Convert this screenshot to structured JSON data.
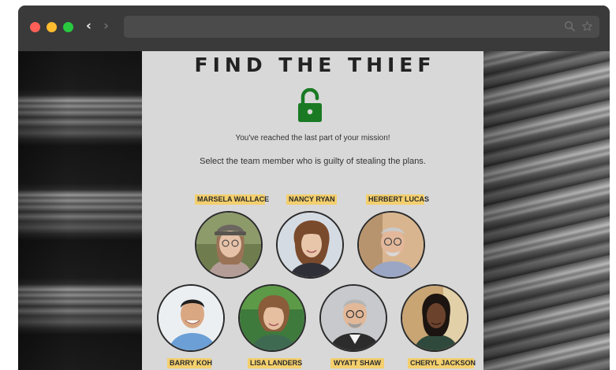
{
  "browser": {
    "window_controls": [
      "close",
      "minimize",
      "maximize"
    ],
    "nav": {
      "back": "‹",
      "forward": "›"
    },
    "address_bar": {
      "value": "",
      "icons": [
        "search-icon",
        "star-icon"
      ]
    }
  },
  "page": {
    "title": "FIND THE THIEF",
    "icon": "unlocked-padlock-icon",
    "icon_color": "#1a7a24",
    "message_1": "You've reached the last part of your mission!",
    "message_2": "Select the team member who is guilty of stealing the plans.",
    "label_color": "#f3cf6d",
    "suspects": [
      {
        "name": "MARSELA WALLACE"
      },
      {
        "name": "NANCY RYAN"
      },
      {
        "name": "HERBERT LUCAS"
      },
      {
        "name": "BARRY KOH"
      },
      {
        "name": "LISA LANDERS"
      },
      {
        "name": "WYATT SHAW"
      },
      {
        "name": "CHERYL JACKSON"
      }
    ]
  }
}
